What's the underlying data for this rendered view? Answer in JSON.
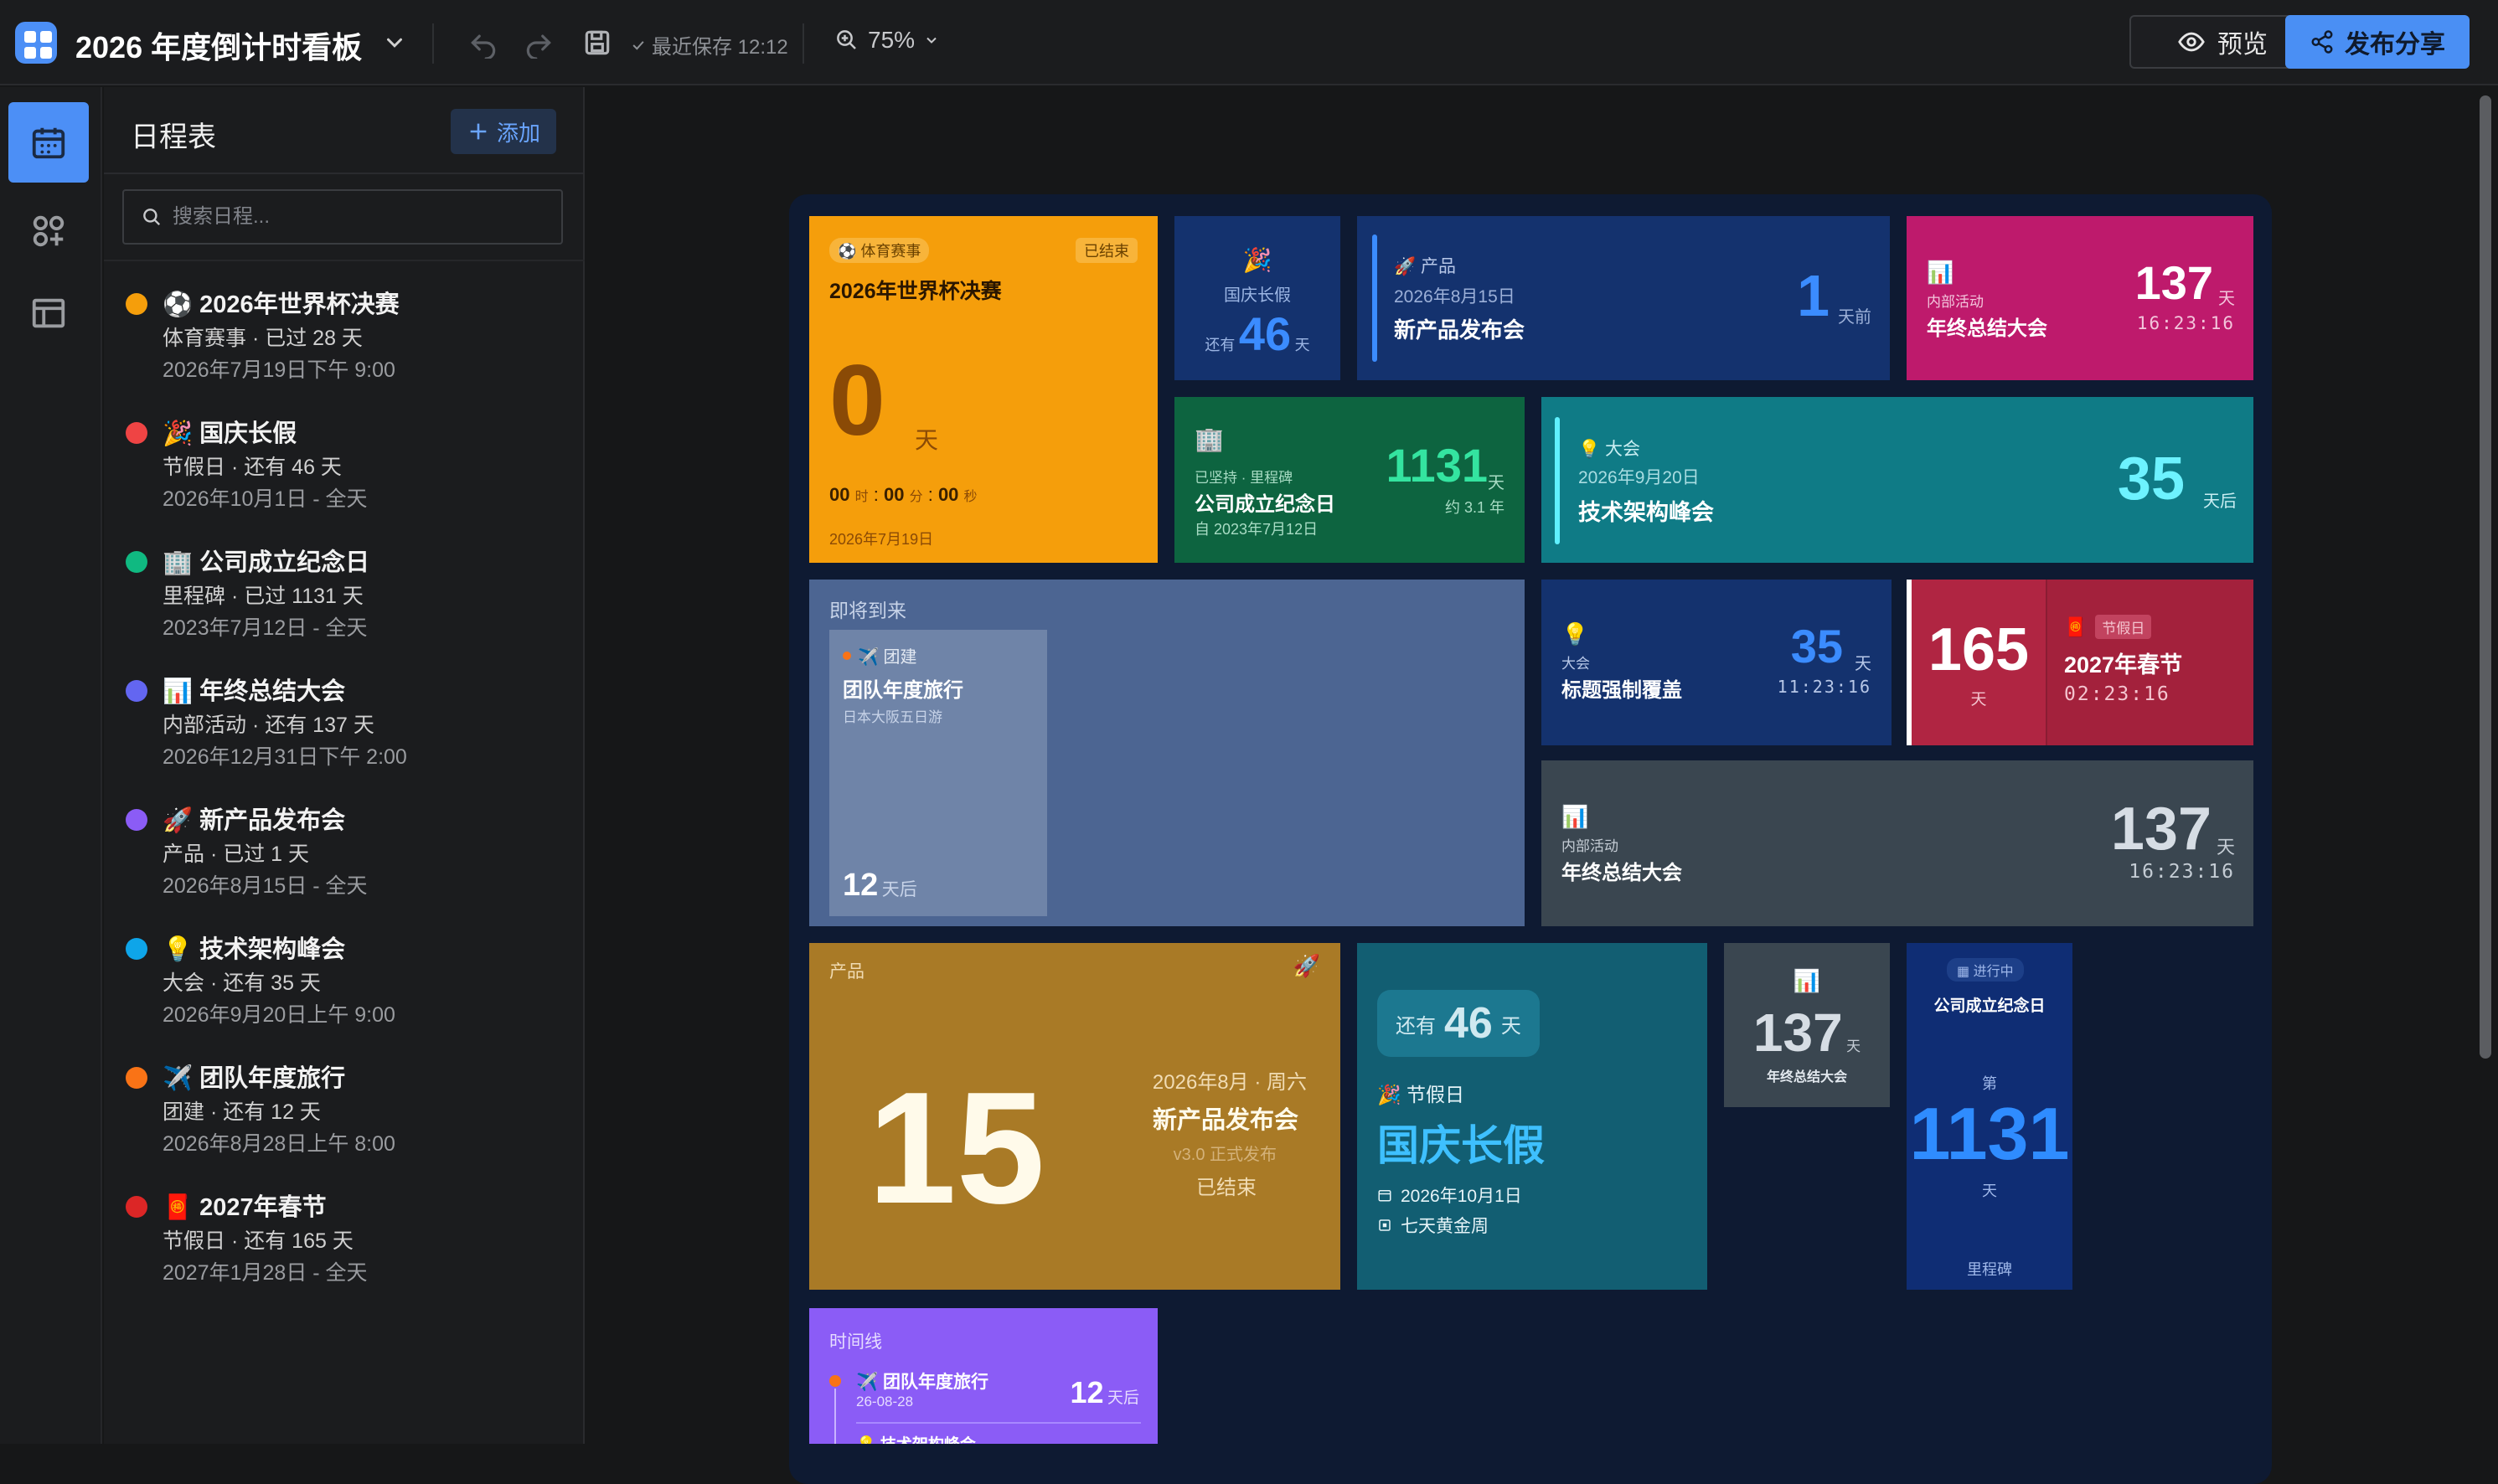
{
  "app": {
    "title": "2026 年度倒计时看板",
    "save_status": "最近保存 12:12",
    "zoom": "75%",
    "preview_label": "预览",
    "publish_label": "发布分享"
  },
  "panel": {
    "title": "日程表",
    "add_label": "添加",
    "search_placeholder": "搜索日程...",
    "items": [
      {
        "name": "⚽ 2026年世界杯决赛",
        "meta": "体育赛事 · 已过 28 天",
        "date": "2026年7月19日下午 9:00",
        "color": "#f59e0b"
      },
      {
        "name": "🎉 国庆长假",
        "meta": "节假日 · 还有 46 天",
        "date": "2026年10月1日 - 全天",
        "color": "#ef4444"
      },
      {
        "name": "🏢 公司成立纪念日",
        "meta": "里程碑 · 已过 1131 天",
        "date": "2023年7月12日 - 全天",
        "color": "#10b981"
      },
      {
        "name": "📊 年终总结大会",
        "meta": "内部活动 · 还有 137 天",
        "date": "2026年12月31日下午 2:00",
        "color": "#6366f1"
      },
      {
        "name": "🚀 新产品发布会",
        "meta": "产品 · 已过 1 天",
        "date": "2026年8月15日 - 全天",
        "color": "#8b5cf6"
      },
      {
        "name": "💡 技术架构峰会",
        "meta": "大会 · 还有 35 天",
        "date": "2026年9月20日上午 9:00",
        "color": "#0ea5e9"
      },
      {
        "name": "✈️ 团队年度旅行",
        "meta": "团建 · 还有 12 天",
        "date": "2026年8月28日上午 8:00",
        "color": "#f97316"
      },
      {
        "name": "🧧 2027年春节",
        "meta": "节假日 · 还有 165 天",
        "date": "2027年1月28日 - 全天",
        "color": "#dc2626"
      }
    ]
  },
  "cards": {
    "worldcup": {
      "tag": "⚽ 体育赛事",
      "status": "已结束",
      "title": "2026年世界杯决赛",
      "days": "0",
      "unit": "天",
      "h": "00",
      "h_u": "时",
      "m": "00",
      "m_u": "分",
      "s": "00",
      "s_u": "秒",
      "date": "2026年7月19日"
    },
    "guoqing_small": {
      "emoji": "🎉",
      "label": "国庆长假",
      "prefix": "还有",
      "days": "46",
      "unit": "天"
    },
    "product_wide": {
      "tag": "🚀 产品",
      "date": "2026年8月15日",
      "title": "新产品发布会",
      "days": "1",
      "unit": "天前"
    },
    "yearend_pink": {
      "emoji": "📊",
      "tag": "内部活动",
      "title": "年终总结大会",
      "days": "137",
      "unit": "天",
      "time": "16:23:16"
    },
    "company_green": {
      "emoji": "🏢",
      "tag": "已坚持 · 里程碑",
      "title": "公司成立纪念日",
      "since": "自 2023年7月12日",
      "days": "1131",
      "unit": "天",
      "approx": "约 3.1 年"
    },
    "tech_teal": {
      "tag": "💡 大会",
      "date": "2026年9月20日",
      "title": "技术架构峰会",
      "days": "35",
      "unit": "天后"
    },
    "upcoming": {
      "header": "即将到来",
      "tag": "✈️ 团建",
      "title": "团队年度旅行",
      "desc": "日本大阪五日游",
      "days": "12",
      "unit": "天后"
    },
    "override": {
      "emoji": "💡",
      "tag": "大会",
      "title": "标题强制覆盖",
      "days": "35",
      "unit": "天",
      "time": "11:23:16"
    },
    "spring": {
      "days": "165",
      "unit": "天",
      "emoji": "🧧",
      "tag": "节假日",
      "title": "2027年春节",
      "time": "02:23:16"
    },
    "yearend_gray": {
      "emoji": "📊",
      "tag": "内部活动",
      "title": "年终总结大会",
      "days": "137",
      "unit": "天",
      "time": "16:23:16"
    },
    "product_gold": {
      "header": "产品",
      "emoji": "🚀",
      "big": "15",
      "date": "2026年8月 · 周六",
      "title": "新产品发布会",
      "sub": "v3.0 正式发布",
      "status": "已结束"
    },
    "holiday_teal": {
      "prefix": "还有",
      "days": "46",
      "unit": "天",
      "tag": "🎉 节假日",
      "title": "国庆长假",
      "date": "2026年10月1日",
      "note": "七天黄金周"
    },
    "yearend_mini": {
      "emoji": "📊",
      "days": "137",
      "unit": "天",
      "title": "年终总结大会"
    },
    "company_tall": {
      "badge": "进行中",
      "title": "公司成立纪念日",
      "prefix": "第",
      "days": "1131",
      "unit": "天",
      "foot": "里程碑"
    },
    "timeline": {
      "header": "时间线",
      "item1": "✈️ 团队年度旅行",
      "item1_date": "26-08-28",
      "item1_days": "12",
      "item1_unit": "天后",
      "item2": "💡 技术架构峰会"
    }
  }
}
